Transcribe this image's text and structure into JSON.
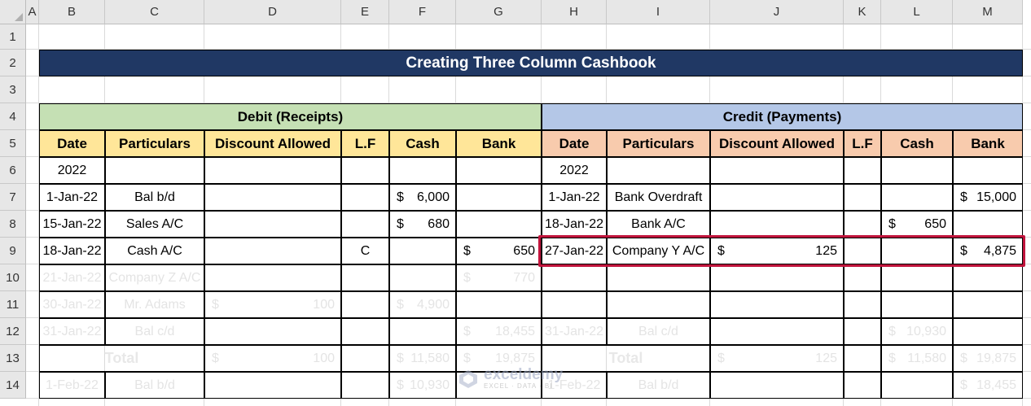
{
  "columns": [
    "A",
    "B",
    "C",
    "D",
    "E",
    "F",
    "G",
    "H",
    "I",
    "J",
    "K",
    "L",
    "M"
  ],
  "rows": [
    "1",
    "2",
    "3",
    "4",
    "5",
    "6",
    "7",
    "8",
    "9",
    "10",
    "11",
    "12",
    "13",
    "14"
  ],
  "sheet": {
    "title": "Creating Three Column Cashbook",
    "debit_title": "Debit (Receipts)",
    "credit_title": "Credit (Payments)",
    "headers": [
      "Date",
      "Particulars",
      "Discount Allowed",
      "L.F",
      "Cash",
      "Bank"
    ],
    "currency": "$",
    "debit": [
      {
        "date": "2022",
        "particulars": "",
        "discount": "",
        "lf": "",
        "cash": "",
        "bank": ""
      },
      {
        "date": "1-Jan-22",
        "particulars": "Bal b/d",
        "discount": "",
        "lf": "",
        "cash": "6,000",
        "bank": ""
      },
      {
        "date": "15-Jan-22",
        "particulars": "Sales A/C",
        "discount": "",
        "lf": "",
        "cash": "680",
        "bank": ""
      },
      {
        "date": "18-Jan-22",
        "particulars": "Cash A/C",
        "discount": "",
        "lf": "C",
        "cash": "",
        "bank": "650"
      },
      {
        "date": "21-Jan-22",
        "particulars": "Company Z A/C",
        "discount": "",
        "lf": "",
        "cash": "",
        "bank": "770"
      },
      {
        "date": "30-Jan-22",
        "particulars": "Mr. Adams",
        "discount": "100",
        "lf": "",
        "cash": "4,900",
        "bank": ""
      },
      {
        "date": "31-Jan-22",
        "particulars": "Bal c/d",
        "discount": "",
        "lf": "",
        "cash": "",
        "bank": "18,455"
      }
    ],
    "credit": [
      {
        "date": "2022",
        "particulars": "",
        "discount": "",
        "lf": "",
        "cash": "",
        "bank": ""
      },
      {
        "date": "1-Jan-22",
        "particulars": "Bank Overdraft",
        "discount": "",
        "lf": "",
        "cash": "",
        "bank": "15,000"
      },
      {
        "date": "18-Jan-22",
        "particulars": "Bank A/C",
        "discount": "",
        "lf": "",
        "cash": "650",
        "bank": ""
      },
      {
        "date": "27-Jan-22",
        "particulars": "Company Y A/C",
        "discount": "125",
        "lf": "",
        "cash": "",
        "bank": "4,875"
      },
      {
        "date": "",
        "particulars": "",
        "discount": "",
        "lf": "",
        "cash": "",
        "bank": ""
      },
      {
        "date": "",
        "particulars": "",
        "discount": "",
        "lf": "",
        "cash": "",
        "bank": ""
      },
      {
        "date": "31-Jan-22",
        "particulars": "Bal c/d",
        "discount": "",
        "lf": "",
        "cash": "10,930",
        "bank": ""
      }
    ],
    "total_label": "Total",
    "debit_total": {
      "discount": "100",
      "cash": "11,580",
      "bank": "19,875"
    },
    "credit_total": {
      "discount": "125",
      "cash": "11,580",
      "bank": "19,875"
    },
    "debit_bd": {
      "date": "1-Feb-22",
      "particulars": "Bal b/d",
      "cash": "10,930"
    },
    "credit_bd": {
      "date": "1-Feb-22",
      "particulars": "Bal b/d",
      "bank": "18,455"
    }
  },
  "watermark": {
    "name": "exceldemy",
    "tagline": "EXCEL · DATA · BI"
  },
  "colors": {
    "title_bg": "#203864",
    "debit_bg": "#c5e0b4",
    "credit_bg": "#b4c7e7",
    "debit_hdr": "#ffe699",
    "credit_hdr": "#f8cbad",
    "highlight": "#c0143c"
  }
}
